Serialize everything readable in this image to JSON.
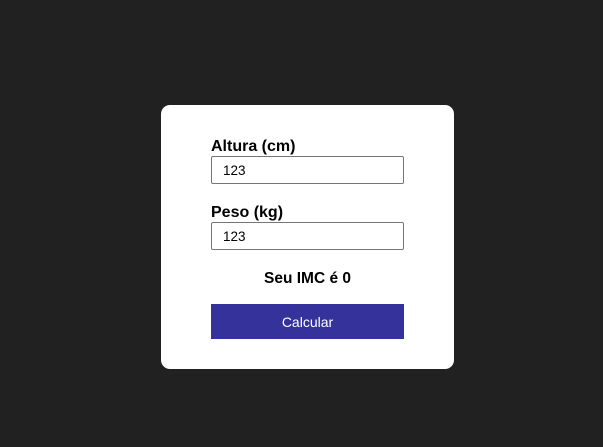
{
  "form": {
    "height_label": "Altura (cm)",
    "height_value": "123",
    "weight_label": "Peso (kg)",
    "weight_value": "123",
    "result_prefix": "Seu IMC é",
    "result_value": "0",
    "result_text": "Seu IMC é 0",
    "calculate_label": "Calcular"
  },
  "colors": {
    "background": "#212121",
    "card": "#ffffff",
    "button": "#35339b",
    "button_text": "#ffffff"
  }
}
